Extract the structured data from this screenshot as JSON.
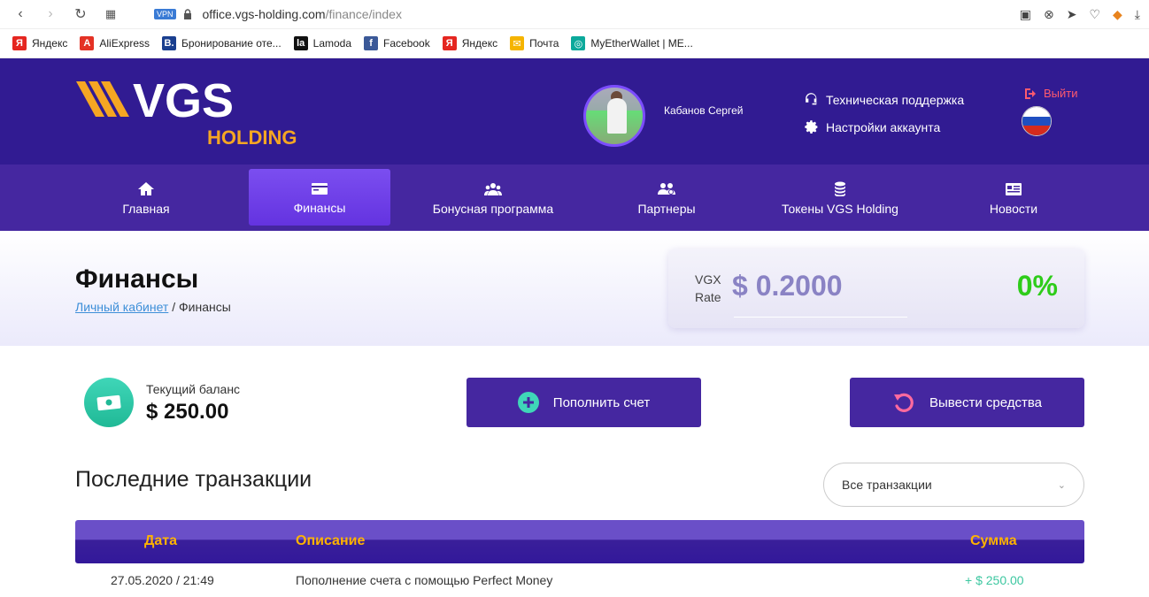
{
  "browser": {
    "vpn_label": "VPN",
    "url_domain": "office.vgs-holding.com",
    "url_path": "/finance/index"
  },
  "bookmarks": [
    {
      "label": "Яндекс",
      "icon": "yandex-icon",
      "color": "#e52620",
      "glyph": "Я"
    },
    {
      "label": "AliExpress",
      "icon": "aliexpress-icon",
      "color": "#e43225",
      "glyph": "A"
    },
    {
      "label": "Бронирование оте...",
      "icon": "booking-icon",
      "color": "#1a3f8f",
      "glyph": "B."
    },
    {
      "label": "Lamoda",
      "icon": "lamoda-icon",
      "color": "#111111",
      "glyph": "la"
    },
    {
      "label": "Facebook",
      "icon": "facebook-icon",
      "color": "#3b5998",
      "glyph": "f"
    },
    {
      "label": "Яндекс",
      "icon": "yandex-icon",
      "color": "#e52620",
      "glyph": "Я"
    },
    {
      "label": "Почта",
      "icon": "mail-icon",
      "color": "#f5b400",
      "glyph": "✉"
    },
    {
      "label": "MyEtherWallet | ME...",
      "icon": "myetherwallet-icon",
      "color": "#0ca99b",
      "glyph": "◎"
    }
  ],
  "header": {
    "logo_text": "VGS",
    "logo_sub": "HOLDING",
    "username": "Кабанов Сергей",
    "support_label": "Техническая поддержка",
    "settings_label": "Настройки аккаунта",
    "logout_label": "Выйти"
  },
  "nav": [
    {
      "label": "Главная",
      "icon": "home-icon"
    },
    {
      "label": "Финансы",
      "icon": "card-icon",
      "active": true
    },
    {
      "label": "Бонусная программа",
      "icon": "users-icon"
    },
    {
      "label": "Партнеры",
      "icon": "partners-icon"
    },
    {
      "label": "Токены VGS Holding",
      "icon": "coins-icon"
    },
    {
      "label": "Новости",
      "icon": "news-icon"
    }
  ],
  "page": {
    "title": "Финансы",
    "breadcrumb_link": "Личный кабинет",
    "breadcrumb_sep": " / ",
    "breadcrumb_current": "Финансы"
  },
  "rate": {
    "label_line1": "VGX",
    "label_line2": "Rate",
    "value": "$ 0.2000",
    "change": "0%"
  },
  "balance": {
    "label": "Текущий баланс",
    "value": "$ 250.00"
  },
  "actions": {
    "deposit_label": "Пополнить счет",
    "withdraw_label": "Вывести средства"
  },
  "transactions": {
    "title": "Последние транзакции",
    "filter_value": "Все транзакции",
    "columns": [
      "Дата",
      "Описание",
      "Сумма"
    ],
    "rows": [
      {
        "date": "27.05.2020 / 21:49",
        "description": "Пополнение счета с помощью Perfect Money",
        "amount": "+ $ 250.00"
      }
    ]
  },
  "colors": {
    "header_bg": "#311b92",
    "nav_bg": "#4527a0",
    "nav_active": "#6a3de8",
    "accent_orange": "#ffb300",
    "positive_green": "#2ecc1a",
    "amount_green": "#3cc7a0"
  }
}
